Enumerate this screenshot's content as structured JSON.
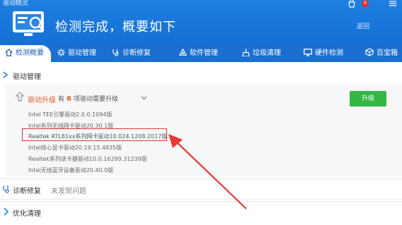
{
  "app_title": "驱动精灵",
  "header": {
    "title": "检测完成，概要如下",
    "back": "返回",
    "badge": "6"
  },
  "tabs": [
    {
      "label": "检测概要",
      "icon": "home-icon"
    },
    {
      "label": "驱动管理",
      "icon": "gear-icon"
    },
    {
      "label": "诊断修复",
      "icon": "stethoscope-icon"
    },
    {
      "label": "软件管理",
      "icon": "software-icon"
    },
    {
      "label": "垃圾清理",
      "icon": "broom-icon"
    },
    {
      "label": "硬件检测",
      "icon": "monitor-icon"
    },
    {
      "label": "百宝箱",
      "icon": "box-icon"
    }
  ],
  "sections": {
    "driver_manage": "驱动管理",
    "diagnose": {
      "label": "诊断修复",
      "status": "未发现问题"
    },
    "optimize": "优化清理"
  },
  "upgrade": {
    "title": "驱动升级",
    "prefix": "有",
    "count": "6",
    "suffix": "项驱动需要升级",
    "button": "升级"
  },
  "drivers": [
    "Intel TEE引擎驱动2.0.0.1094版",
    "Intel系列无线网卡驱动20.30.1版",
    "Realtek RTL81xx系列网卡驱动10.024.1208.2017版",
    "Intel核心显卡驱动20.19.15.4835版",
    "Realtek系列读卡器驱动10.0.16299.31239版",
    "Intel无线蓝牙设备驱动20.40.0版"
  ],
  "colors": {
    "header": "#1d7fe0",
    "accent": "#e35b26",
    "button": "#34b745",
    "highlight": "#e53935"
  }
}
